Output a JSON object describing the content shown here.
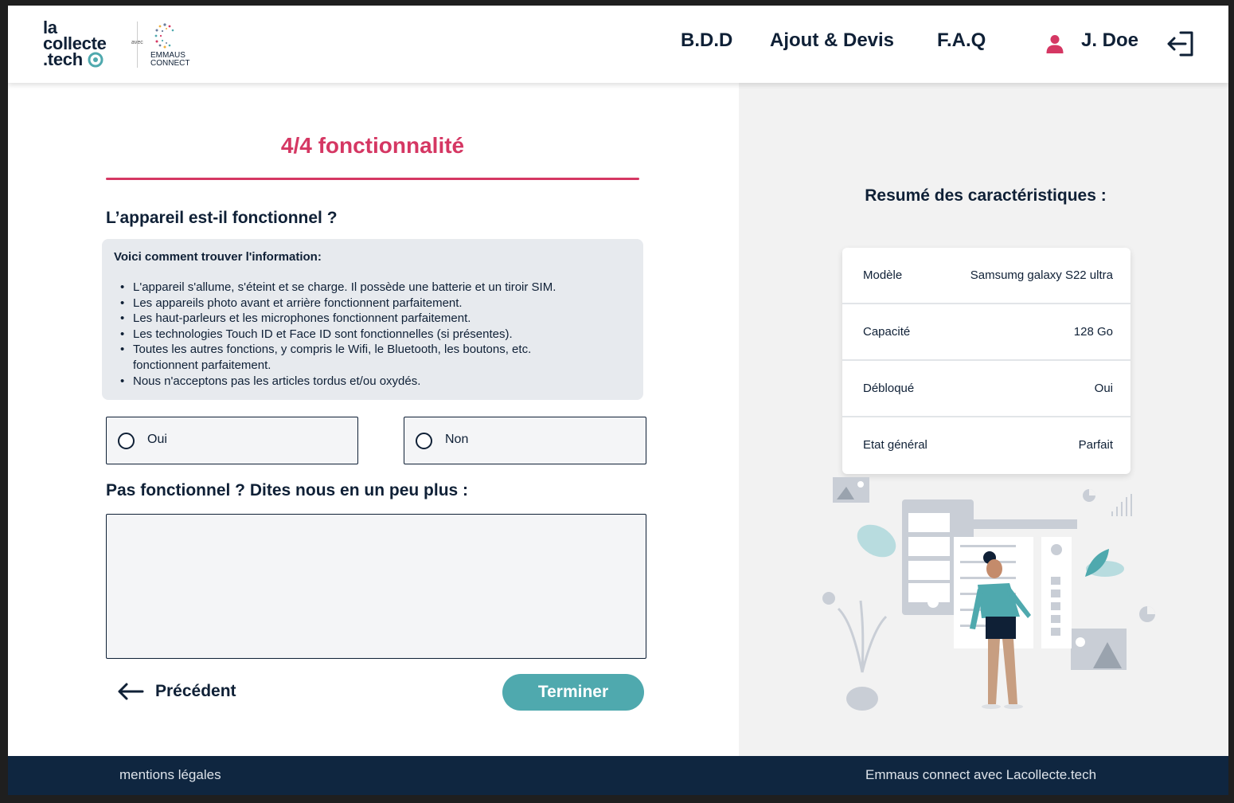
{
  "header": {
    "logo": {
      "line1": "la",
      "line2": "collecte",
      "line3": ".tech",
      "avec": "avec",
      "partner_line1": "EMMAUS",
      "partner_line2": "CONNECT"
    },
    "nav": [
      {
        "label": "B.D.D"
      },
      {
        "label": "Ajout & Devis"
      },
      {
        "label": "F.A.Q"
      }
    ],
    "user": {
      "name": "J. Doe"
    }
  },
  "form": {
    "step_title": "4/4  fonctionnalité",
    "question": "L’appareil est-il fonctionnel ?",
    "info_title": "Voici comment trouver l'information:",
    "info_items": [
      "L'appareil s'allume, s'éteint et se charge. Il possède une batterie et un tiroir SIM.",
      "Les appareils photo avant et arrière fonctionnent parfaitement.",
      "Les haut-parleurs et les microphones fonctionnent parfaitement.",
      "Les technologies Touch ID et Face ID sont fonctionnelles (si présentes).",
      "Toutes les autres fonctions, y compris le Wifi, le Bluetooth, les boutons, etc. fonctionnent parfaitement.",
      "Nous n'acceptons pas les articles tordus et/ou oxydés."
    ],
    "options": [
      {
        "label": "Oui"
      },
      {
        "label": "Non"
      }
    ],
    "details_question": "Pas fonctionnel ? Dites nous en un peu plus :",
    "details_value": "",
    "prev_label": "Précédent",
    "finish_label": "Terminer"
  },
  "summary": {
    "title": "Resumé des caractéristiques :",
    "rows": [
      {
        "key": "Modèle",
        "value": "Samsumg galaxy S22 ultra"
      },
      {
        "key": "Capacité",
        "value": "128 Go"
      },
      {
        "key": "Débloqué",
        "value": "Oui"
      },
      {
        "key": "Etat général",
        "value": "Parfait"
      }
    ]
  },
  "footer": {
    "legal": "mentions légales",
    "credit": "Emmaus connect avec Lacollecte.tech"
  },
  "colors": {
    "accent": "#d53763",
    "navy": "#0f2036",
    "teal": "#4fa9ae",
    "footer_bg": "#0f2640",
    "panel_bg": "#f2f2f2"
  },
  "icons": [
    "user-icon",
    "logout-icon",
    "arrow-left-icon",
    "radio-icon"
  ]
}
